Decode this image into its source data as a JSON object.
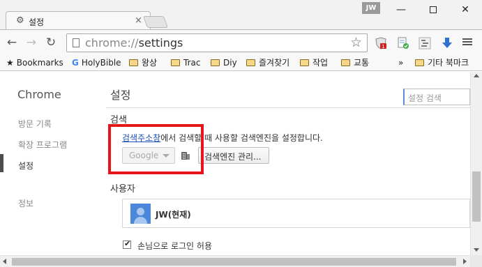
{
  "window": {
    "tab_title": "설정",
    "tab_close": "×",
    "user_badge": "JW",
    "minimize": "—",
    "close": "✕"
  },
  "toolbar": {
    "back": "←",
    "forward": "→",
    "reload": "↻",
    "url_scheme": "chrome://",
    "url_path": "settings",
    "star": "☆"
  },
  "bookmarks": {
    "items": [
      {
        "label": "Bookmarks",
        "icon": "star-icon"
      },
      {
        "label": "HolyBible",
        "icon": "google-icon"
      },
      {
        "label": "왕상",
        "icon": "folder-icon"
      },
      {
        "label": "Trac",
        "icon": "folder-icon"
      },
      {
        "label": "Diy",
        "icon": "folder-icon"
      },
      {
        "label": "즐겨찾기",
        "icon": "folder-icon"
      },
      {
        "label": "작업",
        "icon": "folder-icon"
      },
      {
        "label": "교통",
        "icon": "folder-icon"
      },
      {
        "label": "기타 북마크",
        "icon": "folder-icon"
      }
    ],
    "overflow": "»"
  },
  "sidebar": {
    "brand": "Chrome",
    "items": [
      {
        "label": "방문 기록"
      },
      {
        "label": "확장 프로그램"
      },
      {
        "label": "설정"
      },
      {
        "label": "정보"
      }
    ]
  },
  "main": {
    "title": "설정",
    "search_placeholder": "설정 검색",
    "search_section": {
      "title": "검색",
      "link_text": "검색주소창",
      "desc_rest": "에서 검색할 때 사용할 검색엔진을 설정합니다.",
      "engine_value": "Google",
      "manage_button": "검색엔진 관리..."
    },
    "users_section": {
      "title": "사용자",
      "user_name": "JW(현재)",
      "guest_label": "손님으로 로그인 허용",
      "guest_checked": true
    }
  },
  "colors": {
    "highlight": "#e4161c",
    "link": "#1a4fb8",
    "avatar": "#4c87d9"
  }
}
